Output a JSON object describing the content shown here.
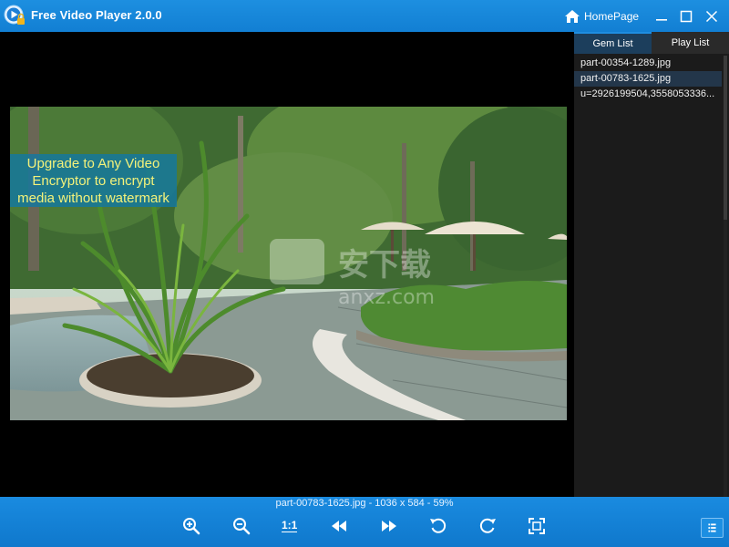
{
  "app": {
    "title": "Free Video Player 2.0.0",
    "homepage_label": "HomePage"
  },
  "tabs": [
    {
      "label": "Gem List",
      "active": true
    },
    {
      "label": "Play List",
      "active": false
    }
  ],
  "files": [
    {
      "name": "part-00354-1289.jpg",
      "selected": false
    },
    {
      "name": "part-00783-1625.jpg",
      "selected": true
    },
    {
      "name": "u=2926199504,3558053336...",
      "selected": false
    }
  ],
  "promo": {
    "line1": "Upgrade to Any Video",
    "line2": "Encryptor to encrypt",
    "line3": "media without watermark"
  },
  "status": "part-00783-1625.jpg - 1036 x 584 - 59%",
  "toolbar": {
    "one_to_one_label": "1:1",
    "icons": [
      "zoom-in-icon",
      "zoom-out-icon",
      "actual-size-icon",
      "previous-icon",
      "next-icon",
      "rotate-left-icon",
      "rotate-right-icon",
      "fit-screen-icon",
      "list-icon"
    ]
  },
  "colors": {
    "titlebar": "#1a8be0",
    "promo_text": "#f4f27a",
    "promo_bg": "#1478a0",
    "panel_bg": "#1b1b1b",
    "selected_row": "#23364a"
  }
}
